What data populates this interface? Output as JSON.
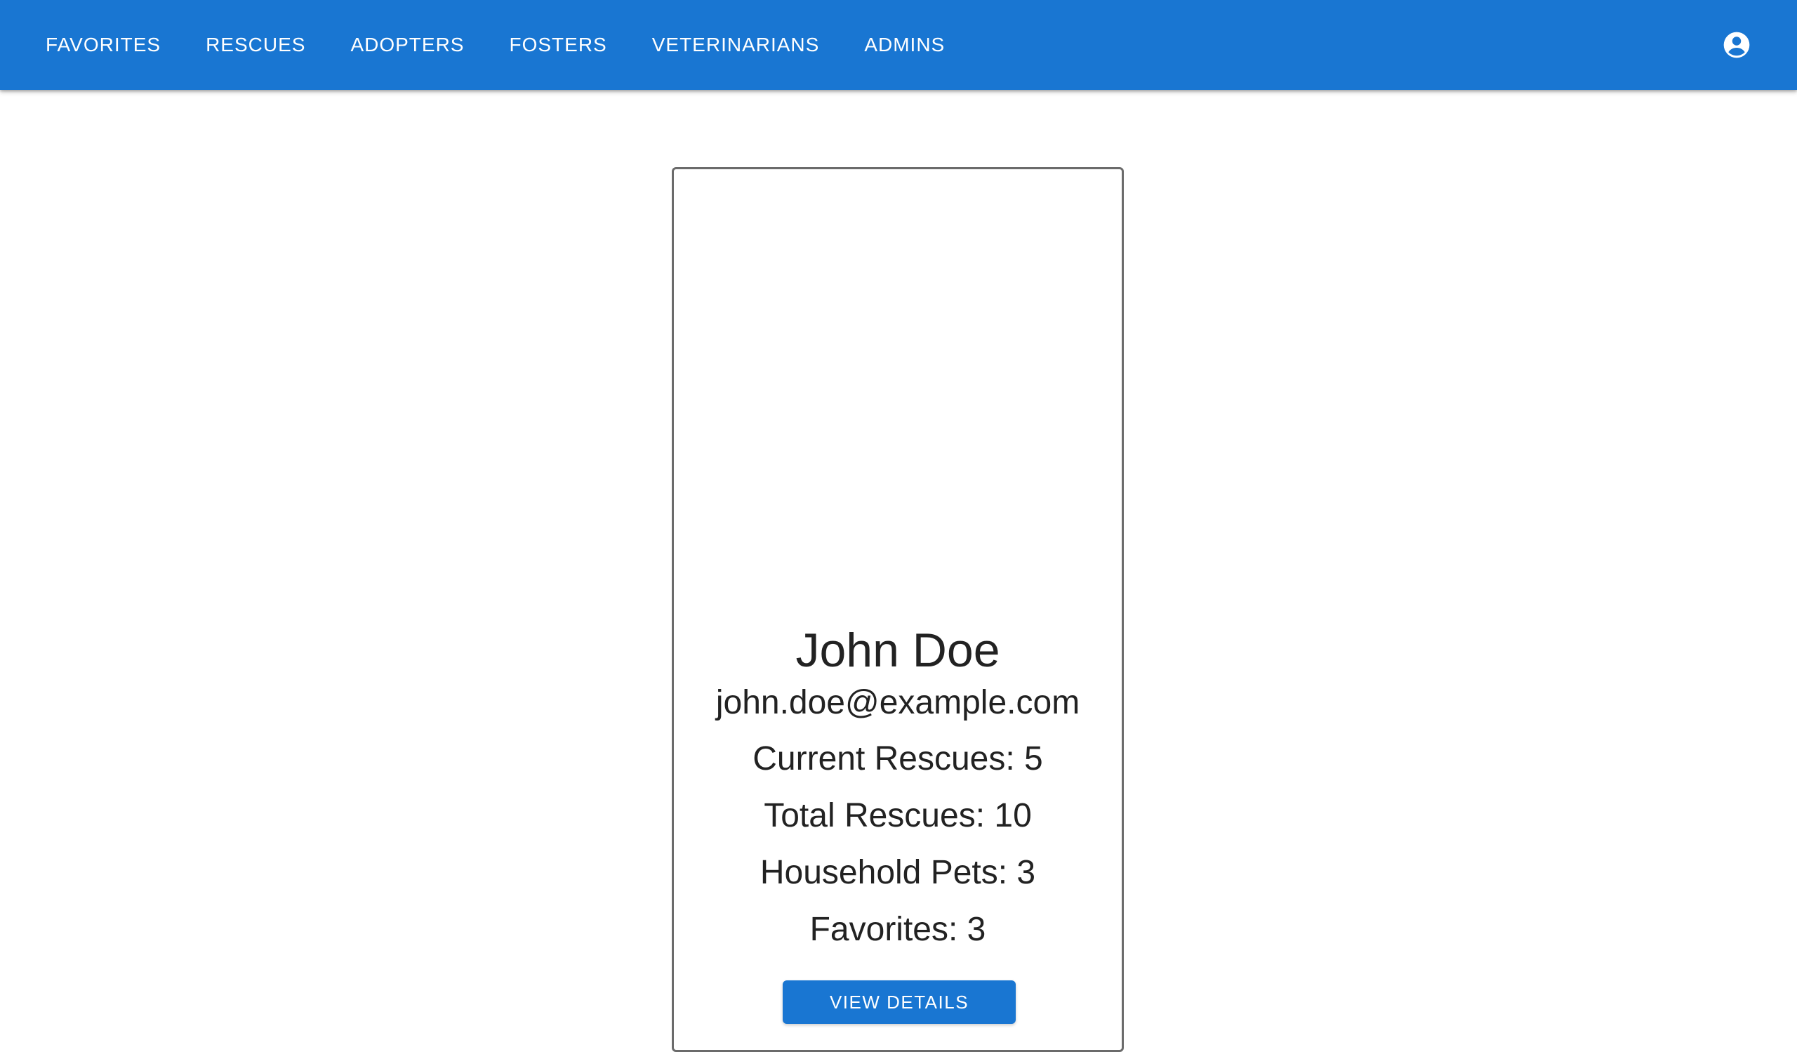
{
  "nav": {
    "items": [
      {
        "label": "FAVORITES"
      },
      {
        "label": "RESCUES"
      },
      {
        "label": "ADOPTERS"
      },
      {
        "label": "FOSTERS"
      },
      {
        "label": "VETERINARIANS"
      },
      {
        "label": "ADMINS"
      }
    ],
    "account_icon": "account-circle-icon"
  },
  "profile": {
    "name": "John Doe",
    "email": "john.doe@example.com",
    "current_rescues": "Current Rescues: 5",
    "total_rescues": "Total Rescues: 10",
    "household_pets": "Household Pets: 3",
    "favorites": "Favorites: 3",
    "button_label": "VIEW DETAILS"
  },
  "colors": {
    "primary": "#1976d2",
    "text": "#222222",
    "card_border": "#6b6b6b"
  }
}
